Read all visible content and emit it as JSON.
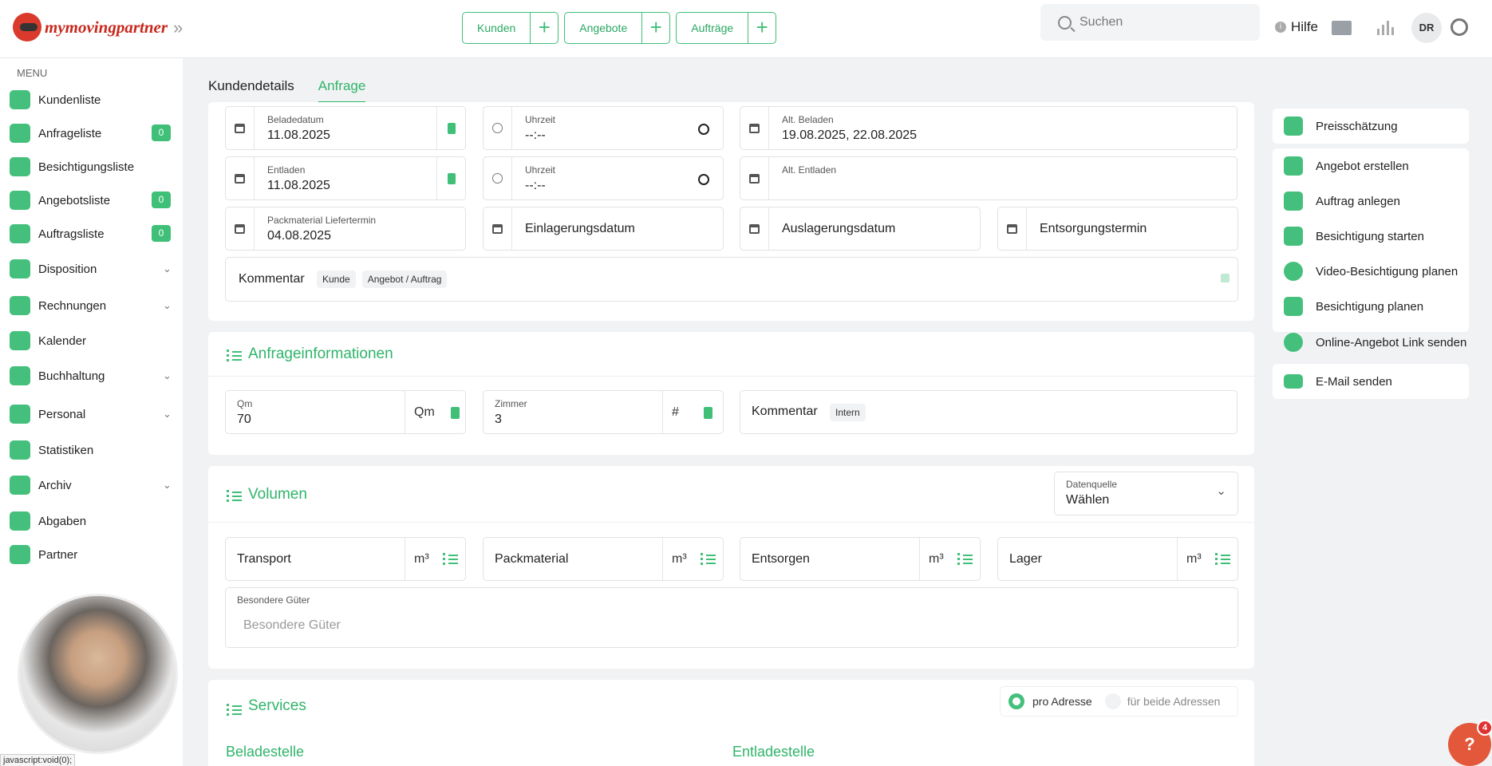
{
  "app": {
    "logo_text": "mymovingpartner"
  },
  "topbar": {
    "buttons": [
      {
        "label": "Kunden"
      },
      {
        "label": "Angebote"
      },
      {
        "label": "Aufträge"
      }
    ],
    "plus": "+",
    "search_placeholder": "Suchen",
    "help": "Hilfe",
    "help_info": "i",
    "avatar": "DR"
  },
  "sidebar": {
    "heading": "MENU",
    "items": [
      {
        "label": "Kundenliste"
      },
      {
        "label": "Anfrageliste",
        "badge": "0"
      },
      {
        "label": "Besichtigungsliste"
      },
      {
        "label": "Angebotsliste",
        "badge": "0"
      },
      {
        "label": "Auftragsliste",
        "badge": "0"
      },
      {
        "label": "Disposition"
      },
      {
        "label": "Rechnungen"
      },
      {
        "label": "Kalender"
      },
      {
        "label": "Buchhaltung"
      },
      {
        "label": "Personal"
      },
      {
        "label": "Statistiken"
      },
      {
        "label": "Archiv"
      },
      {
        "label": "Abgaben"
      },
      {
        "label": "Partner"
      }
    ]
  },
  "tabs": [
    {
      "label": "Kundendetails"
    },
    {
      "label": "Anfrage"
    }
  ],
  "dates": {
    "beladedatum": {
      "label": "Beladedatum",
      "value": "11.08.2025"
    },
    "uhrzeit1": {
      "label": "Uhrzeit",
      "value": "--:--"
    },
    "alt_beladen": {
      "label": "Alt. Beladen",
      "value": "19.08.2025, 22.08.2025"
    },
    "entladen": {
      "label": "Entladen",
      "value": "11.08.2025"
    },
    "uhrzeit2": {
      "label": "Uhrzeit",
      "value": "--:--"
    },
    "alt_entladen": {
      "label": "Alt. Entladen"
    },
    "packmaterial": {
      "label": "Packmaterial Liefertermin",
      "value": "04.08.2025"
    },
    "einlagerung": "Einlagerungsdatum",
    "auslagerung": "Auslagerungsdatum",
    "entsorgung": "Entsorgungstermin",
    "kommentar": {
      "label": "Kommentar",
      "chip1": "Kunde",
      "chip2": "Angebot / Auftrag"
    }
  },
  "anfrage": {
    "title": "Anfrageinformationen",
    "qm": {
      "label": "Qm",
      "value": "70",
      "unit": "Qm"
    },
    "zimmer": {
      "label": "Zimmer",
      "value": "3",
      "unit": "#"
    },
    "kommentar": {
      "label": "Kommentar",
      "chip": "Intern"
    }
  },
  "volumen": {
    "title": "Volumen",
    "datenquelle": {
      "label": "Datenquelle",
      "value": "Wählen"
    },
    "fields": [
      {
        "label": "Transport",
        "unit": "m³"
      },
      {
        "label": "Packmaterial",
        "unit": "m³"
      },
      {
        "label": "Entsorgen",
        "unit": "m³"
      },
      {
        "label": "Lager",
        "unit": "m³"
      }
    ],
    "besondere": {
      "label": "Besondere Güter",
      "placeholder": "Besondere Güter"
    }
  },
  "services": {
    "title": "Services",
    "radio1": "pro Adresse",
    "radio2": "für beide Adressen",
    "beladestelle": "Beladestelle",
    "entladestelle": "Entladestelle"
  },
  "actions": [
    {
      "label": "Preisschätzung"
    },
    {
      "label": "Angebot erstellen"
    },
    {
      "label": "Auftrag anlegen"
    },
    {
      "label": "Besichtigung starten"
    },
    {
      "label": "Video-Besichtigung planen"
    },
    {
      "label": "Besichtigung planen"
    },
    {
      "label": "Online-Angebot Link senden"
    },
    {
      "label": "E-Mail senden"
    }
  ],
  "status_text": "javascript:void(0);",
  "help_fab": {
    "label": "?",
    "count": "4"
  },
  "colors": {
    "accent": "#3fbf77",
    "accent_dark": "#2fb46a",
    "fab": "#e3583a"
  }
}
